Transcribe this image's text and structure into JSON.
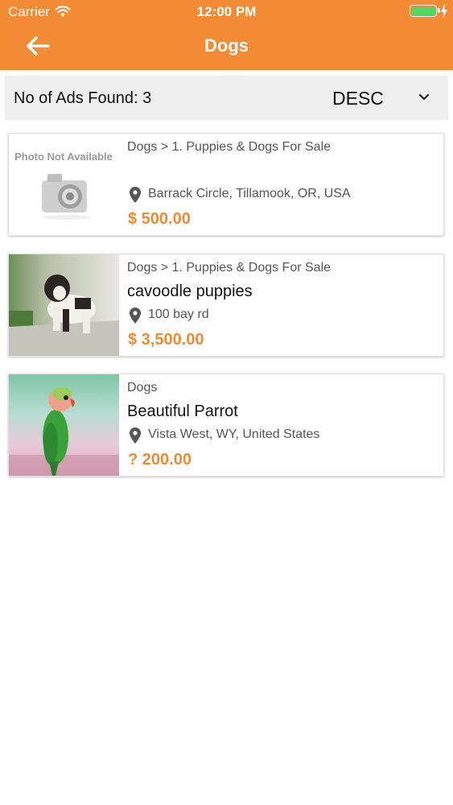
{
  "status_bar": {
    "carrier": "Carrier",
    "time": "12:00 PM",
    "icons": [
      "wifi-icon",
      "battery-icon",
      "charging-icon"
    ]
  },
  "header": {
    "title": "Dogs",
    "back_icon": "arrow-left-icon",
    "background_color": "#F38A34"
  },
  "results": {
    "count_label": "No of Ads Found: 3",
    "sort_value": "DESC",
    "sort_icon": "chevron-down-icon"
  },
  "listings": [
    {
      "category": "Dogs > 1. Puppies & Dogs For Sale",
      "title": "",
      "image": "photo-not-available-placeholder",
      "placeholder_text": "Photo Not Available",
      "location": "Barrack Circle, Tillamook, OR, USA",
      "price": "$ 500.00"
    },
    {
      "category": "Dogs > 1. Puppies & Dogs For Sale",
      "title": "cavoodle puppies",
      "image": "bulldog-photo",
      "location": "100 bay rd",
      "price": "$ 3,500.00"
    },
    {
      "category": "Dogs",
      "title": "Beautiful Parrot",
      "image": "parrot-photo",
      "location": "Vista West, WY, United States",
      "price": "? 200.00"
    }
  ],
  "colors": {
    "accent": "#F38A34",
    "price": "#F08A33",
    "results_bar": "#EEEEEF"
  }
}
